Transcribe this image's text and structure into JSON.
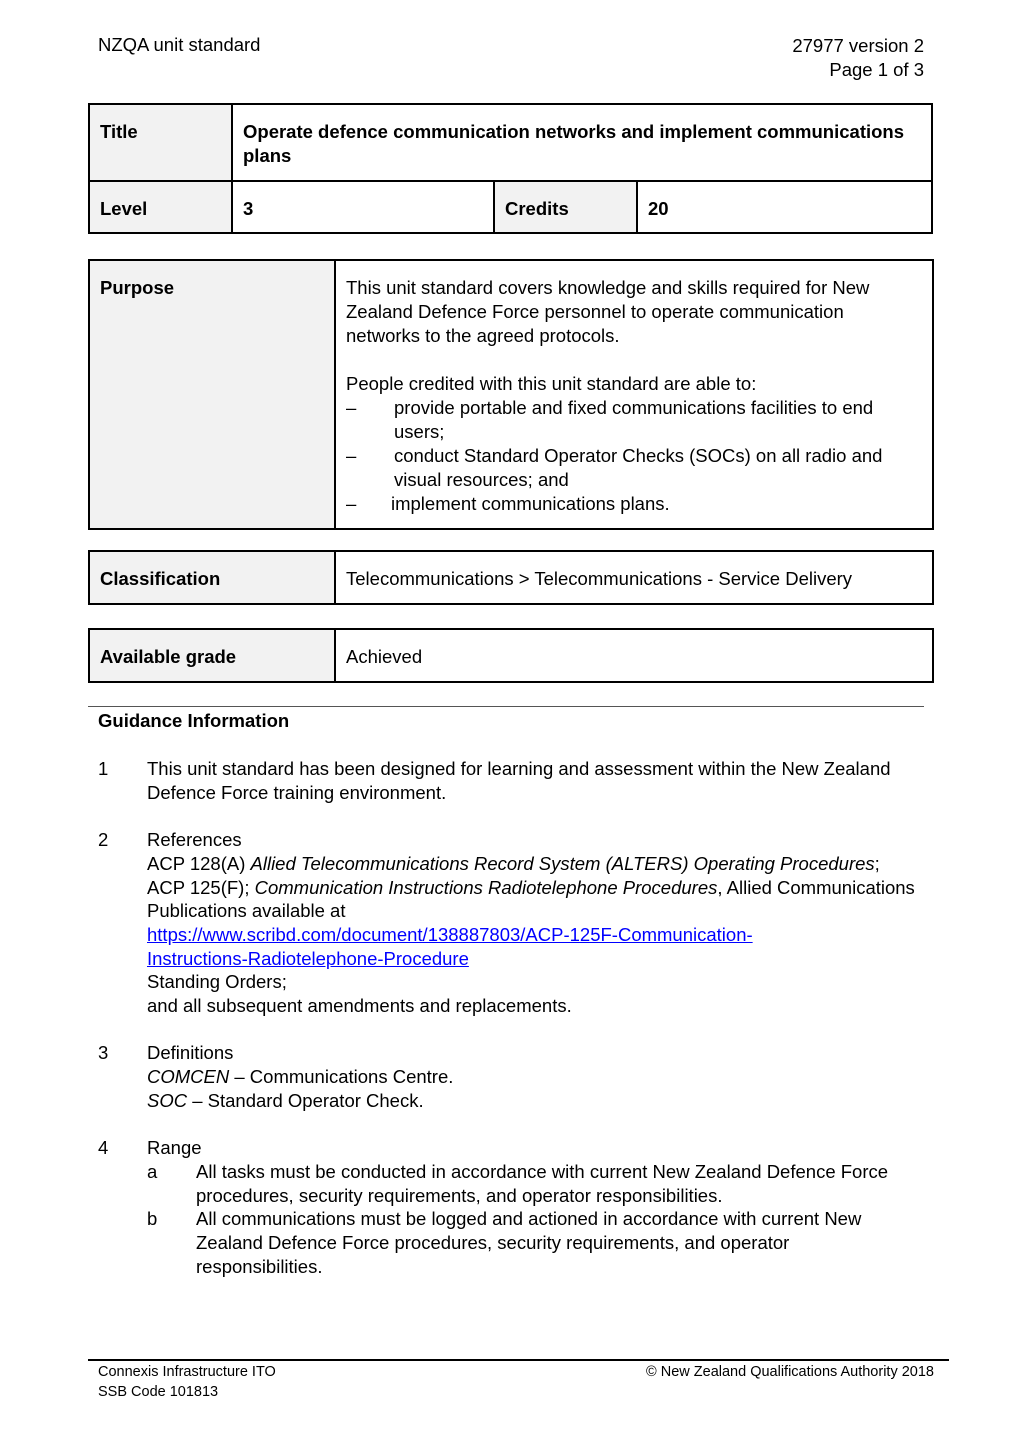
{
  "header": {
    "left": "NZQA unit standard",
    "right_line1": "27977 version 2",
    "right_line2": "Page 1 of 3"
  },
  "summary": {
    "title_label": "Title",
    "title_value": "Operate defence communication networks and implement communications plans",
    "level_label": "Level",
    "level_value": "3",
    "credits_label": "Credits",
    "credits_value": "20"
  },
  "purpose": {
    "label": "Purpose",
    "paragraph": "This unit standard covers knowledge and skills required for New Zealand Defence Force personnel to operate communication networks to the agreed protocols.",
    "intro": "People credited with this unit standard are able to:",
    "dash": "–",
    "items": [
      "provide portable and fixed communications facilities to end users;",
      "conduct Standard Operator Checks (SOCs) on all radio and visual resources; and",
      "implement communications plans."
    ]
  },
  "classification": {
    "label": "Classification",
    "value": "Telecommunications > Telecommunications - Service Delivery"
  },
  "grade": {
    "label": "Available grade",
    "value": "Achieved"
  },
  "guidance": {
    "title": "Guidance Information",
    "item1": {
      "num": "1",
      "text": "This unit standard has been designed for learning and assessment within the New Zealand Defence Force training environment."
    },
    "item2": {
      "num": "2",
      "heading": "References",
      "ref1_prefix": "ACP 128(A) ",
      "ref1_italic": "Allied Telecommunications Record System (ALTERS) Operating Procedures",
      "ref1_suffix": ";",
      "ref2_prefix": "ACP 125(F); ",
      "ref2_italic": "Communication Instructions Radiotelephone Procedures",
      "ref2_suffix": ", Allied Communications Publications available at",
      "link_line1": "https://www.scribd.com/document/138887803/ACP-125F-Communication-",
      "link_line2": "Instructions-Radiotelephone-Procedure",
      "standing": "Standing Orders;",
      "amend": "and all subsequent amendments and replacements."
    },
    "item3": {
      "num": "3",
      "heading": "Definitions",
      "defs": [
        {
          "term": "COMCEN",
          "desc": " – Communications Centre."
        },
        {
          "term": "SOC",
          "desc": " – Standard Operator Check."
        }
      ]
    },
    "item4": {
      "num": "4",
      "heading": "Range",
      "subs": [
        {
          "letter": "a",
          "text": "All tasks must be conducted in accordance with current New Zealand Defence Force procedures, security requirements, and operator responsibilities."
        },
        {
          "letter": "b",
          "text": "All communications must be logged and actioned in accordance with current New Zealand Defence Force procedures, security requirements, and operator responsibilities."
        }
      ]
    }
  },
  "footer": {
    "org": "Connexis Infrastructure ITO",
    "ssb": "SSB Code 101813",
    "copyright_symbol": "©",
    "copyright": " New Zealand Qualifications Authority 2018"
  },
  "colors": {
    "label_bg": "#f2f2f2",
    "link": "#0000ff"
  }
}
